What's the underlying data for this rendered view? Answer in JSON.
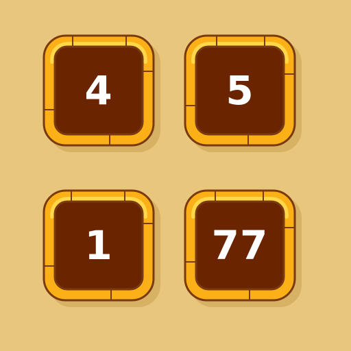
{
  "board": {
    "tiles": [
      {
        "value": "4"
      },
      {
        "value": "5"
      },
      {
        "value": "1"
      },
      {
        "value": "77"
      }
    ]
  },
  "colors": {
    "background": "#e9c67d",
    "frame_gold": "#fcb018",
    "frame_highlight": "#ffd84a",
    "frame_outline": "#7a3a10",
    "tile_face": "#6b2400",
    "number": "#ffffff"
  }
}
